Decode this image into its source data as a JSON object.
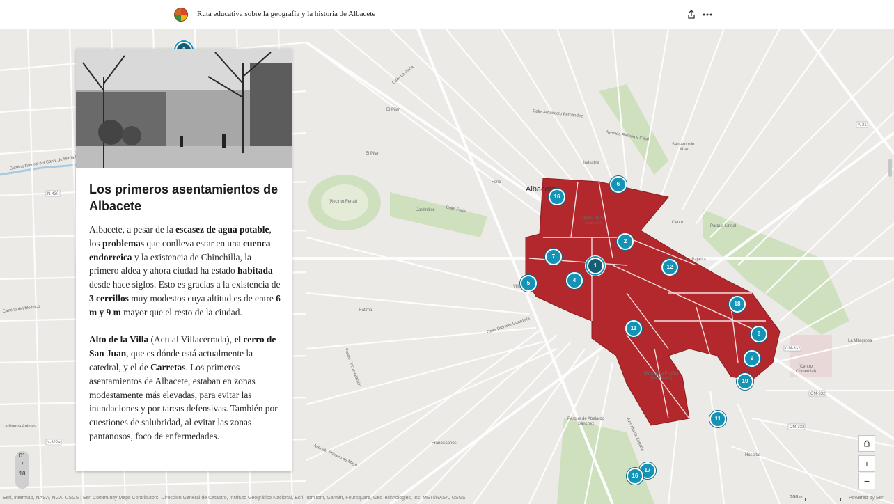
{
  "header": {
    "title": "Ruta educativa sobre la geografía y la historia de Albacete",
    "share_icon": "share-icon",
    "more_icon": "more-icon"
  },
  "panel": {
    "heading": "Los primeros asentamientos de Albacete",
    "paragraph1": [
      {
        "t": "Albacete, a pesar de la ",
        "b": false
      },
      {
        "t": "escasez de agua potable",
        "b": true
      },
      {
        "t": ", los ",
        "b": false
      },
      {
        "t": "problemas",
        "b": true
      },
      {
        "t": " que conlleva estar en una ",
        "b": false
      },
      {
        "t": "cuenca endorreica",
        "b": true
      },
      {
        "t": " y la existencia de Chinchilla, la primero aldea y ahora ciudad ha estado ",
        "b": false
      },
      {
        "t": "habitada",
        "b": true
      },
      {
        "t": " desde hace siglos. Esto es gracias a la existencia de ",
        "b": false
      },
      {
        "t": "3 cerrillos",
        "b": true
      },
      {
        "t": " muy modestos cuya altitud es de entre ",
        "b": false
      },
      {
        "t": "6 m y 9 m",
        "b": true
      },
      {
        "t": " mayor que el resto de la ciudad.",
        "b": false
      }
    ],
    "paragraph2": [
      {
        "t": "Alto de la Villa",
        "b": true
      },
      {
        "t": " (Actual Villacerrada), ",
        "b": false
      },
      {
        "t": "el cerro de San Juan",
        "b": true
      },
      {
        "t": ", que es dónde está actualmente la catedral, y el de ",
        "b": false
      },
      {
        "t": "Carretas",
        "b": true
      },
      {
        "t": ". Los primeros asentamientos de Albacete, estaban en zonas modestamente más elevadas, para evitar las inundaciones y por tareas defensivas. También por cuestiones de salubridad, al evitar las zonas pantanosos, foco de enfermedades.",
        "b": false
      }
    ]
  },
  "pager": {
    "current": "01",
    "sep": "/",
    "total": "18"
  },
  "markers": [
    "1",
    "2",
    "4",
    "5",
    "6",
    "7",
    "8",
    "9",
    "10",
    "11",
    "12",
    "13",
    "14",
    "16",
    "17",
    "18"
  ],
  "active_marker": "1",
  "map_labels": {
    "city": "Albacete",
    "places": [
      "El Pilar",
      "El Pilar",
      "Feria",
      "Industria",
      "San Antonio Abad",
      "Centro",
      "La Pajarita",
      "Fátima",
      "Parque Lineal",
      "La Milagrosa",
      "(Centro Comercial)",
      "(Recinto Ferial)",
      "Jardinillos",
      "Iglesia de la Asunción",
      "Villa",
      "(Biblioteca Pública del Estado)",
      "Parque de Abelardo Sánchez",
      "Franciscanos",
      "Hospital",
      "Camino Natural del Canal de María Cristina",
      "Camino del Molinico",
      "La Huerta Animes",
      "Calle Feria",
      "Calle La Roda",
      "Avenida Ramón y Cajal",
      "Calle Arquitecto Fernández",
      "Paseo Circunvalación",
      "Avenida Primero de Mayo",
      "Calle Dionisio Guardiola",
      "Avenida de España"
    ],
    "roads": [
      "N-430",
      "N-322a",
      "CM-332",
      "CM-332",
      "CM-332",
      "A-31"
    ]
  },
  "controls": {
    "home_icon": "home-icon",
    "zoom_in": "+",
    "zoom_out": "−"
  },
  "footer": {
    "attribution": "Esri, Intermap, NASA, NGA, USGS | Esri Community Maps Contributors, Dirección General de Catastro, Instituto Geográfico Nacional, Esri, TomTom, Garmin, Foursquare, GeoTechnologies, Inc, METI/NASA, USGS",
    "scale": "200 m",
    "powered": "Powered by Esri"
  },
  "colors": {
    "district": "#b2282c",
    "marker": "#1593b6"
  }
}
